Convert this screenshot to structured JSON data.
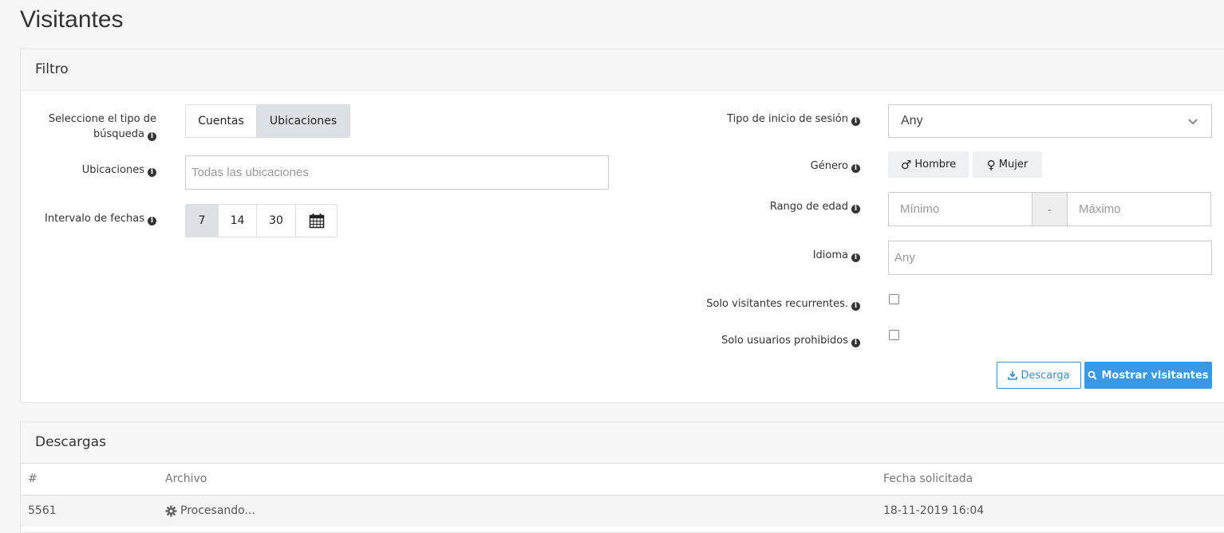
{
  "page": {
    "title": "Visitantes"
  },
  "filter": {
    "title": "Filtro",
    "search_type": {
      "label": "Seleccione el tipo de búsqueda",
      "options": [
        "Cuentas",
        "Ubicaciones"
      ],
      "selected": "Ubicaciones"
    },
    "locations": {
      "label": "Ubicaciones",
      "placeholder": "Todas las ubicaciones"
    },
    "date_range": {
      "label": "Intervalo de fechas",
      "options": [
        "7",
        "14",
        "30"
      ],
      "selected": "7"
    },
    "login_type": {
      "label": "Tipo de inicio de sesión",
      "value": "Any"
    },
    "gender": {
      "label": "Género",
      "options": [
        "Hombre",
        "Mujer"
      ]
    },
    "age_range": {
      "label": "Rango de edad",
      "min_placeholder": "Mínimo",
      "separator": "-",
      "max_placeholder": "Máximo"
    },
    "language": {
      "label": "Idioma",
      "placeholder": "Any"
    },
    "recurring_only": {
      "label": "Solo visitantes recurrentes.",
      "checked": false
    },
    "banned_only": {
      "label": "Solo usuarios prohibidos",
      "checked": false
    },
    "download_button": "Descarga",
    "show_button": "Mostrar visitantes"
  },
  "downloads": {
    "title": "Descargas",
    "columns": [
      "#",
      "Archivo",
      "Fecha solicitada"
    ],
    "rows": [
      {
        "id": "5561",
        "file": "Procesando...",
        "date": "18-11-2019 16:04"
      }
    ]
  },
  "colors": {
    "primary": "#3a98e8",
    "active_segment": "#dde1e6"
  }
}
